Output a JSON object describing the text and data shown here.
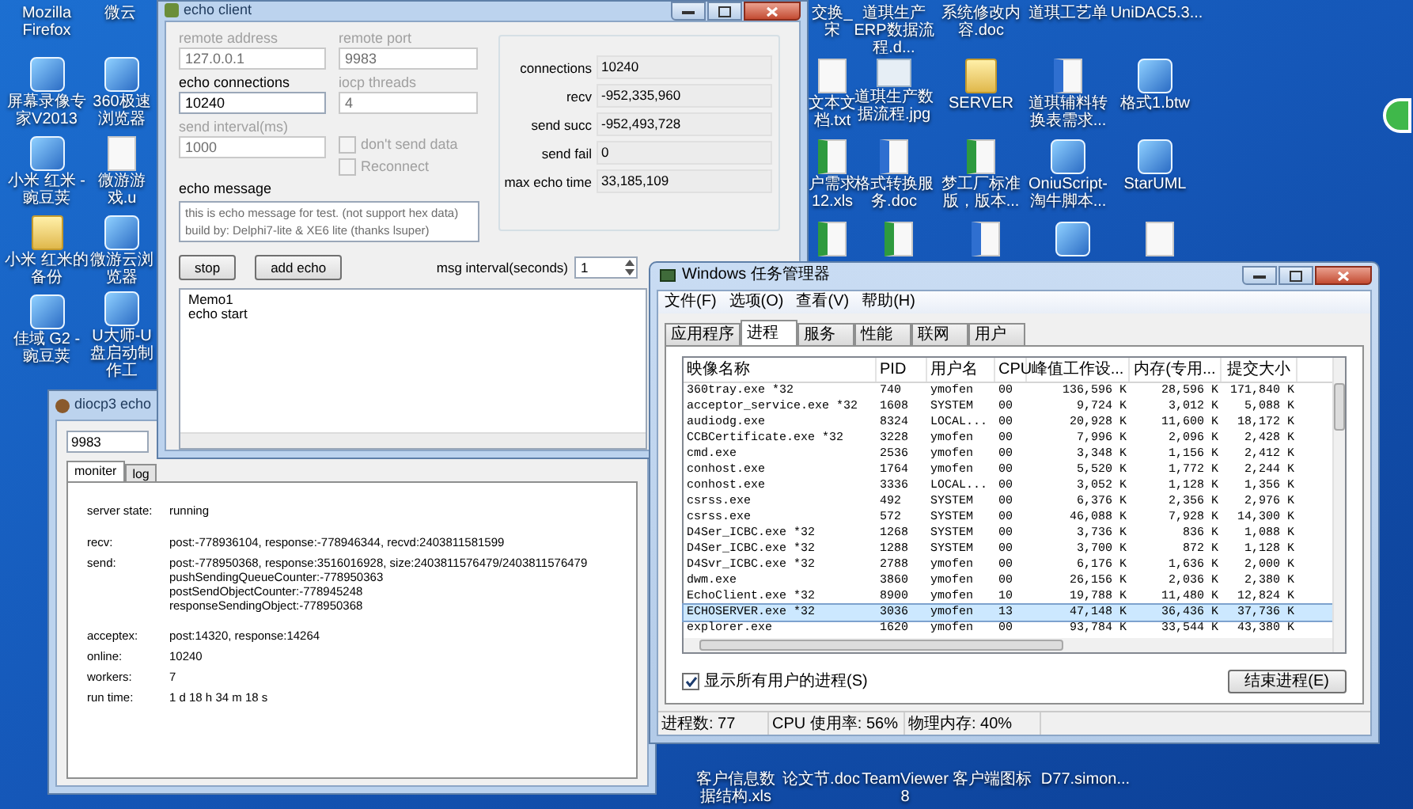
{
  "desktop_icons": [
    {
      "label": "Mozilla Firefox",
      "kind": "none"
    },
    {
      "label": "微云",
      "kind": "none"
    },
    {
      "label": "屏幕录像专家V2013",
      "kind": "app"
    },
    {
      "label": "360极速浏览器",
      "kind": "app"
    },
    {
      "label": "小米 红米 - 豌豆荚",
      "kind": "app"
    },
    {
      "label": "微游游戏.u",
      "kind": "file"
    },
    {
      "label": "小米 红米的备份",
      "kind": "folder"
    },
    {
      "label": "微游云浏览器",
      "kind": "app"
    },
    {
      "label": "佳域 G2 - 豌豆荚",
      "kind": "app"
    },
    {
      "label": "U大师-U盘启动制作工",
      "kind": "app"
    },
    {
      "label": "交换_宋",
      "kind": "none"
    },
    {
      "label": "道琪生产ERP数据流程.d...",
      "kind": "none"
    },
    {
      "label": "系统修改内容.doc",
      "kind": "none"
    },
    {
      "label": "道琪工艺单",
      "kind": "none"
    },
    {
      "label": "UniDAC5.3...",
      "kind": "none"
    },
    {
      "label": "文本文档.txt",
      "kind": "file"
    },
    {
      "label": "道琪生产数据流程.jpg",
      "kind": "image"
    },
    {
      "label": "SERVER",
      "kind": "folder"
    },
    {
      "label": "道琪辅料转换表需求...",
      "kind": "doc"
    },
    {
      "label": "格式1.btw",
      "kind": "app"
    },
    {
      "label": "户需求 12.xls",
      "kind": "sheet"
    },
    {
      "label": "格式转换服务.doc",
      "kind": "doc"
    },
    {
      "label": "梦工厂标准版，版本...",
      "kind": "sheet"
    },
    {
      "label": "OniuScript-淘牛脚本...",
      "kind": "app"
    },
    {
      "label": "StarUML",
      "kind": "app"
    },
    {
      "kind": "sheet"
    },
    {
      "kind": "sheet"
    },
    {
      "kind": "doc"
    },
    {
      "kind": "app"
    },
    {
      "kind": "file"
    },
    {
      "label": "客户信息数据结构.xls",
      "kind": "none"
    },
    {
      "label": "论文节.doc",
      "kind": "none"
    },
    {
      "label": "TeamViewer 8",
      "kind": "none"
    },
    {
      "label": "客户端图标",
      "kind": "none"
    },
    {
      "label": "D77.simon...",
      "kind": "none"
    }
  ],
  "echo_client": {
    "title": "echo client",
    "fields": [
      {
        "label": "remote address",
        "value": "127.0.0.1",
        "disabled": true
      },
      {
        "label": "remote port",
        "value": "9983",
        "disabled": true
      },
      {
        "label": "echo connections",
        "value": "10240",
        "disabled": false
      },
      {
        "label": "iocp threads",
        "value": "4",
        "disabled": true
      },
      {
        "label": "send interval(ms)",
        "value": "1000",
        "disabled": true
      }
    ],
    "checkboxes": [
      {
        "label": "don't send data",
        "checked": false,
        "disabled": true
      },
      {
        "label": "Reconnect",
        "checked": false,
        "disabled": true
      }
    ],
    "echo_message": {
      "label": "echo message",
      "lines": [
        "this is echo message for test. (not support hex data)",
        "build by: Delphi7-lite & XE6 lite (thanks lsuper)"
      ]
    },
    "buttons": [
      "stop",
      "add echo"
    ],
    "stats": [
      {
        "label": "connections",
        "value": "10240"
      },
      {
        "label": "recv",
        "value": "-952,335,960"
      },
      {
        "label": "send succ",
        "value": "-952,493,728"
      },
      {
        "label": "send fail",
        "value": "0"
      },
      {
        "label": "max echo time",
        "value": "33,185,109"
      }
    ],
    "msg_interval": {
      "label": "msg interval(seconds)",
      "value": "1"
    },
    "memo": [
      "Memo1",
      "echo start"
    ]
  },
  "diocp3": {
    "title": "diocp3 echo",
    "port": "9983",
    "tabs": [
      {
        "label": "moniter",
        "selected": true
      },
      {
        "label": "log",
        "selected": false
      }
    ],
    "groups": [
      [
        {
          "label": "server state:",
          "lines": [
            "running"
          ]
        }
      ],
      [
        {
          "label": "recv:",
          "lines": [
            "post:-778936104, response:-778946344, recvd:2403811581599"
          ]
        },
        {
          "label": "send:",
          "lines": [
            "post:-778950368, response:3516016928, size:2403811576479/2403811576479",
            "pushSendingQueueCounter:-778950363",
            "postSendObjectCounter:-778945248",
            "responseSendingObject:-778950368"
          ]
        }
      ],
      [
        {
          "label": "acceptex:",
          "lines": [
            "post:14320, response:14264"
          ]
        },
        {
          "label": "online:",
          "lines": [
            "10240"
          ]
        },
        {
          "label": "workers:",
          "lines": [
            "7"
          ]
        },
        {
          "label": "run time:",
          "lines": [
            "1 d 18 h 34 m 18 s"
          ]
        }
      ]
    ]
  },
  "task_manager": {
    "title": "Windows 任务管理器",
    "menu": [
      "文件(F)",
      "选项(O)",
      "查看(V)",
      "帮助(H)"
    ],
    "tabs": [
      {
        "label": "应用程序",
        "selected": false
      },
      {
        "label": "进程",
        "selected": true
      },
      {
        "label": "服务",
        "selected": false
      },
      {
        "label": "性能",
        "selected": false
      },
      {
        "label": "联网",
        "selected": false
      },
      {
        "label": "用户",
        "selected": false
      }
    ],
    "columns": [
      "映像名称",
      "PID",
      "用户名",
      "CPU",
      "峰值工作设...",
      "内存(专用...",
      "提交大小"
    ],
    "rows": [
      {
        "cells": [
          "360tray.exe *32",
          "740",
          "ymofen",
          "00",
          "136,596 K",
          "28,596 K",
          "171,840 K"
        ],
        "selected": false
      },
      {
        "cells": [
          "acceptor_service.exe *32",
          "1608",
          "SYSTEM",
          "00",
          "9,724 K",
          "3,012 K",
          "5,088 K"
        ],
        "selected": false
      },
      {
        "cells": [
          "audiodg.exe",
          "8324",
          "LOCAL...",
          "00",
          "20,928 K",
          "11,600 K",
          "18,172 K"
        ],
        "selected": false
      },
      {
        "cells": [
          "CCBCertificate.exe *32",
          "3228",
          "ymofen",
          "00",
          "7,996 K",
          "2,096 K",
          "2,428 K"
        ],
        "selected": false
      },
      {
        "cells": [
          "cmd.exe",
          "2536",
          "ymofen",
          "00",
          "3,348 K",
          "1,156 K",
          "2,412 K"
        ],
        "selected": false
      },
      {
        "cells": [
          "conhost.exe",
          "1764",
          "ymofen",
          "00",
          "5,520 K",
          "1,772 K",
          "2,244 K"
        ],
        "selected": false
      },
      {
        "cells": [
          "conhost.exe",
          "3336",
          "LOCAL...",
          "00",
          "3,052 K",
          "1,128 K",
          "1,356 K"
        ],
        "selected": false
      },
      {
        "cells": [
          "csrss.exe",
          "492",
          "SYSTEM",
          "00",
          "6,376 K",
          "2,356 K",
          "2,976 K"
        ],
        "selected": false
      },
      {
        "cells": [
          "csrss.exe",
          "572",
          "SYSTEM",
          "00",
          "46,088 K",
          "7,928 K",
          "14,300 K"
        ],
        "selected": false
      },
      {
        "cells": [
          "D4Ser_ICBC.exe *32",
          "1268",
          "SYSTEM",
          "00",
          "3,736 K",
          "836 K",
          "1,088 K"
        ],
        "selected": false
      },
      {
        "cells": [
          "D4Ser_ICBC.exe *32",
          "1288",
          "SYSTEM",
          "00",
          "3,700 K",
          "872 K",
          "1,128 K"
        ],
        "selected": false
      },
      {
        "cells": [
          "D4Svr_ICBC.exe *32",
          "2788",
          "ymofen",
          "00",
          "6,176 K",
          "1,636 K",
          "2,000 K"
        ],
        "selected": false
      },
      {
        "cells": [
          "dwm.exe",
          "3860",
          "ymofen",
          "00",
          "26,156 K",
          "2,036 K",
          "2,380 K"
        ],
        "selected": false
      },
      {
        "cells": [
          "EchoClient.exe *32",
          "8900",
          "ymofen",
          "10",
          "19,788 K",
          "11,480 K",
          "12,824 K"
        ],
        "selected": false
      },
      {
        "cells": [
          "ECHOSERVER.exe *32",
          "3036",
          "ymofen",
          "13",
          "47,148 K",
          "36,436 K",
          "37,736 K"
        ],
        "selected": true
      },
      {
        "cells": [
          "explorer.exe",
          "1620",
          "ymofen",
          "00",
          "93,784 K",
          "33,544 K",
          "43,380 K"
        ],
        "selected": false
      }
    ],
    "show_all": {
      "label": "显示所有用户的进程(S)",
      "checked": true
    },
    "end_button": "结束进程(E)",
    "status": [
      "进程数: 77",
      "CPU 使用率: 56%",
      "物理内存: 40%"
    ]
  }
}
